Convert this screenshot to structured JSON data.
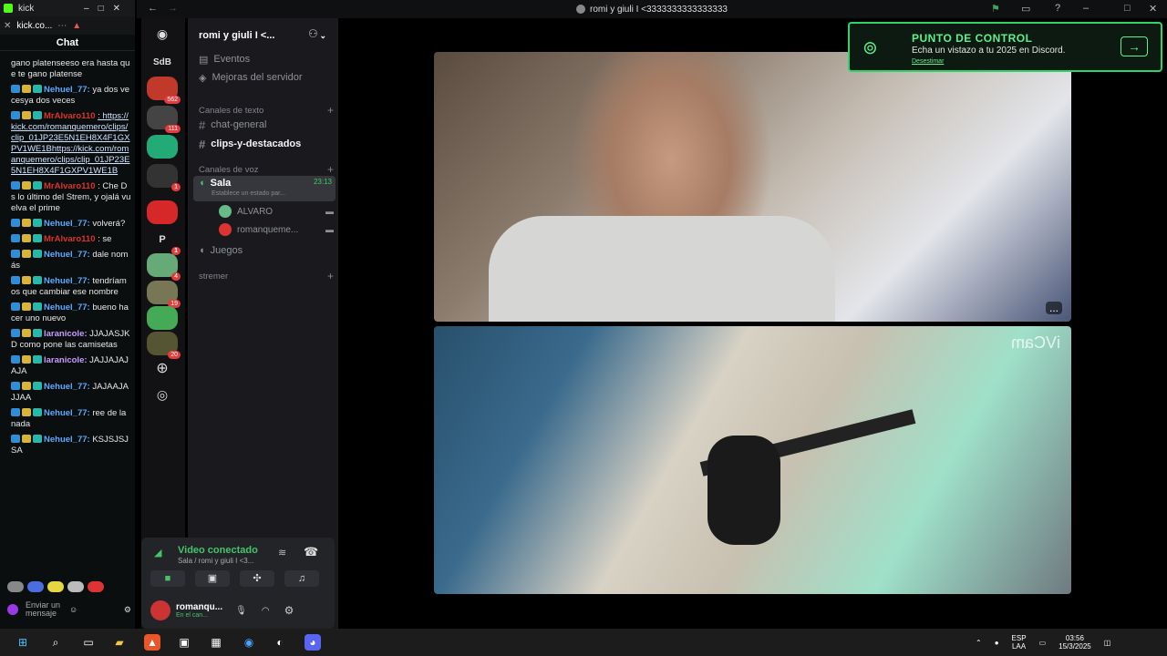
{
  "kick": {
    "tab_title": "kick",
    "tab_domain": "kick.co...",
    "header": "Chat",
    "messages": [
      {
        "user": "",
        "text": "gano platenseeso era hasta que te gano platense",
        "color": "plain"
      },
      {
        "user": "Nehuel_77:",
        "text": "ya dos vecesya dos veces",
        "color": "blue"
      },
      {
        "user": "MrAlvaro110",
        "text": ": https://kick.com/romanquemero/clips/clip_01JP23E5N1EH8X4F1GXPV1WE1Bhttps://kick.com/romanquemero/clips/clip_01JP23E5N1EH8X4F1GXPV1WE1B",
        "color": "red"
      },
      {
        "user": "MrAlvaro110",
        "text": ": Che Ds lo último del Strem, y ojalá vuelva el prime",
        "color": "red"
      },
      {
        "user": "Nehuel_77:",
        "text": "volverá?",
        "color": "blue"
      },
      {
        "user": "MrAlvaro110",
        "text": ": se",
        "color": "red"
      },
      {
        "user": "Nehuel_77:",
        "text": "dale nomás",
        "color": "blue"
      },
      {
        "user": "Nehuel_77:",
        "text": "tendríamos que cambiar ese nombre",
        "color": "blue"
      },
      {
        "user": "Nehuel_77:",
        "text": "bueno hacer uno nuevo",
        "color": "blue"
      },
      {
        "user": "laranicole:",
        "text": "JJAJASJKD como pone las camisetas",
        "color": "purple"
      },
      {
        "user": "laranicole:",
        "text": "JAJJAJAJAJA",
        "color": "purple"
      },
      {
        "user": "Nehuel_77:",
        "text": "JAJAAJAJJAA",
        "color": "blue"
      },
      {
        "user": "Nehuel_77:",
        "text": "ree de la nada",
        "color": "blue"
      },
      {
        "user": "Nehuel_77:",
        "text": "KSJSJSJSA",
        "color": "blue"
      }
    ],
    "send_placeholder": "Enviar un mensaje"
  },
  "titlebar": {
    "title": "romi y giuli I <3333333333333333"
  },
  "servers": {
    "sdb_label": "SdB",
    "badges": [
      "562",
      "111",
      "1",
      "1",
      "4",
      "19",
      "20"
    ],
    "p_label": "P"
  },
  "channels": {
    "server_name": "romi y giuli I <...",
    "events": "Eventos",
    "boosts": "Mejoras del servidor",
    "text_category": "Canales de texto",
    "text_channels": [
      "chat-general",
      "clips-y-destacados"
    ],
    "voice_category": "Canales de voz",
    "voice_channel": "Sala",
    "voice_time": "23:13",
    "voice_status": "Establece un estado par...",
    "voice_members": [
      "ALVARO",
      "romanqueme..."
    ],
    "other_voice": "Juegos",
    "stremer_category": "stremer"
  },
  "voice_panel": {
    "status": "Video conectado",
    "location": "Sala / romi y giuli I <3...",
    "username": "romanqu...",
    "user_status": "En el can..."
  },
  "stage": {
    "watermark": "iVCam",
    "more_label": "..."
  },
  "promo": {
    "title": "PUNTO DE CONTROL",
    "subtitle": "Echa un vistazo a tu 2025 en Discord.",
    "dismiss": "Desestimar"
  },
  "taskbar": {
    "lang_top": "ESP",
    "lang_bottom": "LAA",
    "time": "03:56",
    "date": "15/3/2025"
  },
  "colors": {
    "discord_bg": "#1a1a1e",
    "accent_green": "#2ed36b",
    "kick_bg": "#0b0e0f",
    "mention_red": "#d9342b",
    "user_blue": "#5da9ff"
  }
}
